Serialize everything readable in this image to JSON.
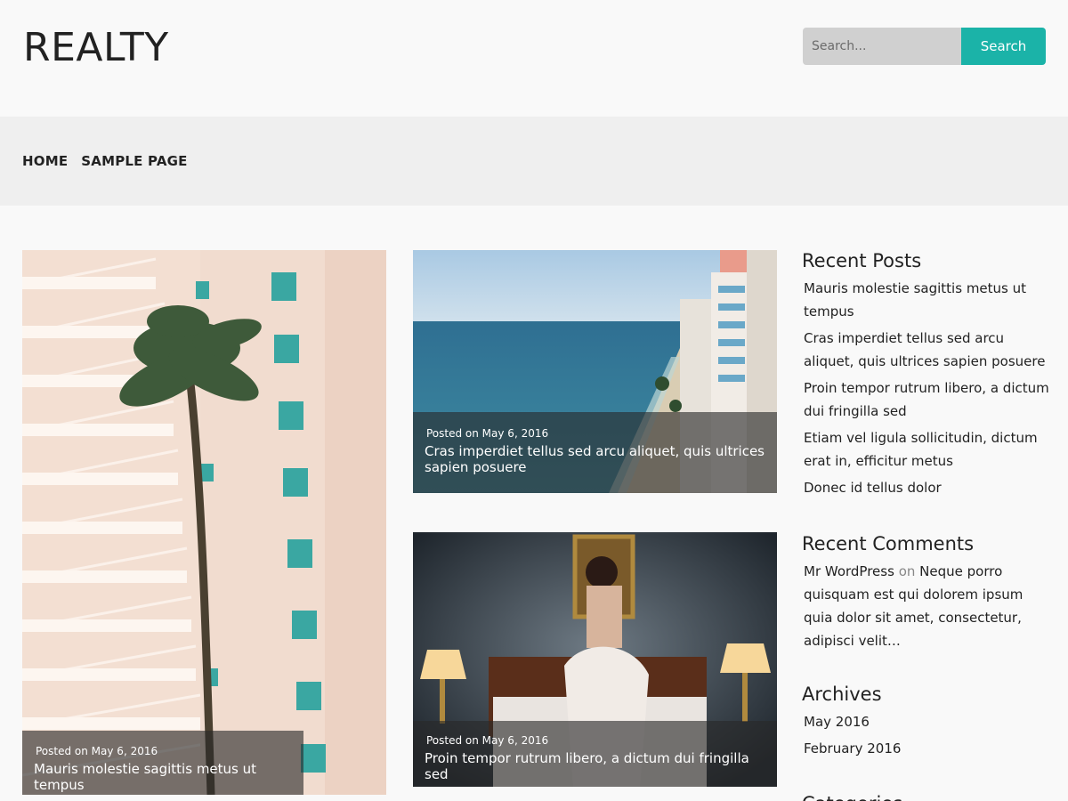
{
  "site": {
    "title": "REALTY"
  },
  "search": {
    "placeholder": "Search...",
    "button_label": "Search"
  },
  "nav": {
    "items": [
      {
        "label": "HOME"
      },
      {
        "label": "SAMPLE PAGE"
      }
    ]
  },
  "posts": [
    {
      "date": "Posted on May 6, 2016",
      "title": "Mauris molestie sagittis metus ut tempus"
    },
    {
      "date": "Posted on May 6, 2016",
      "title": "Cras imperdiet tellus sed arcu aliquet, quis ultrices sapien posuere"
    },
    {
      "date": "Posted on May 6, 2016",
      "title": "Proin tempor rutrum libero, a dictum dui fringilla sed"
    }
  ],
  "sidebar": {
    "recent_posts": {
      "title": "Recent Posts",
      "items": [
        "Mauris molestie sagittis metus ut tempus",
        "Cras imperdiet tellus sed arcu aliquet, quis ultrices sapien posuere",
        "Proin tempor rutrum libero, a dictum dui fringilla sed",
        "Etiam vel ligula sollicitudin, dictum erat in, efficitur metus",
        "Donec id tellus dolor"
      ]
    },
    "recent_comments": {
      "title": "Recent Comments",
      "author": "Mr WordPress",
      "on": "on",
      "post": "Neque porro quisquam est qui dolorem ipsum quia dolor sit amet, consectetur, adipisci velit…"
    },
    "archives": {
      "title": "Archives",
      "items": [
        "May 2016",
        "February 2016"
      ]
    },
    "categories": {
      "title": "Categories"
    }
  },
  "colors": {
    "accent": "#1bb3a8",
    "nav_bg": "#efefef",
    "page_bg": "#f9f9f9"
  }
}
